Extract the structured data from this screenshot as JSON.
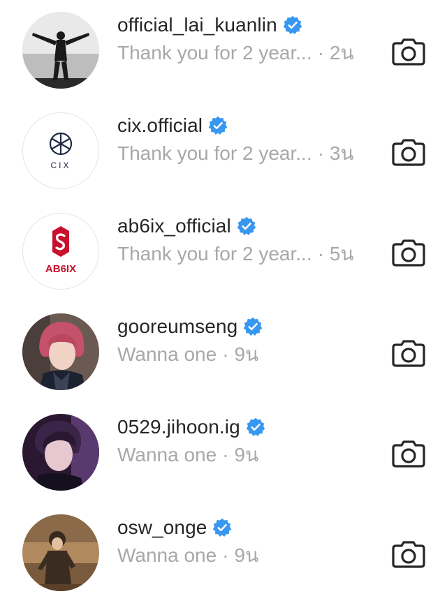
{
  "rows": [
    {
      "username": "official_lai_kuanlin",
      "preview": "Thank you for 2 year...",
      "separator": "·",
      "time": "2น",
      "verified": true,
      "avatar": "person-dancing-bw"
    },
    {
      "username": "cix.official",
      "preview": "Thank you for 2 year...",
      "separator": "·",
      "time": "3น",
      "verified": true,
      "avatar": "cix-logo",
      "avatar_text": "CIX"
    },
    {
      "username": "ab6ix_official",
      "preview": "Thank you for 2 year...",
      "separator": "·",
      "time": "5น",
      "verified": true,
      "avatar": "ab6ix-logo",
      "avatar_text": "AB6IX"
    },
    {
      "username": "gooreumseng",
      "preview": "Wanna one",
      "separator": "·",
      "time": "9น",
      "verified": true,
      "avatar": "person-pink-hair"
    },
    {
      "username": "0529.jihoon.ig",
      "preview": "Wanna one",
      "separator": "·",
      "time": "9น",
      "verified": true,
      "avatar": "person-purple-light"
    },
    {
      "username": "osw_onge",
      "preview": "Wanna one",
      "separator": "·",
      "time": "9น",
      "verified": true,
      "avatar": "person-brown-coat"
    }
  ],
  "icons": {
    "verified": "verified-badge-icon",
    "camera": "camera-icon"
  },
  "colors": {
    "username": "#262626",
    "secondary": "#a8a8a8",
    "verified": "#3897f0",
    "ab6ix_red": "#c8102e",
    "cix_navy": "#1f2a44"
  }
}
